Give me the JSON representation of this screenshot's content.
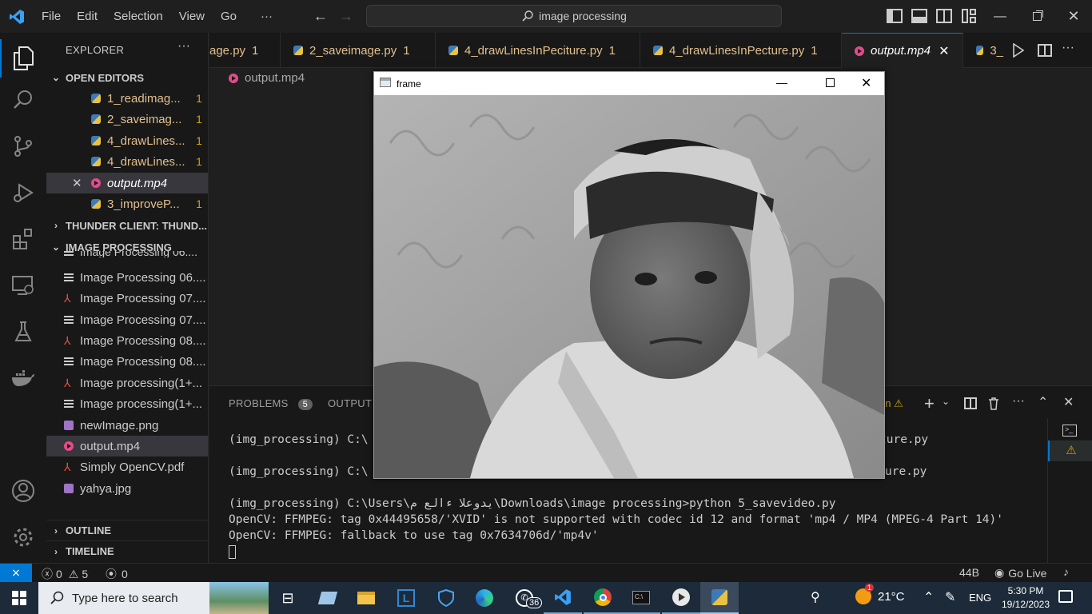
{
  "titlebar": {
    "menus": [
      "File",
      "Edit",
      "Selection",
      "View",
      "Go",
      "···"
    ],
    "search_text": "image processing"
  },
  "sidebar": {
    "explorer_title": "EXPLORER",
    "open_editors_title": "OPEN EDITORS",
    "open_editors": [
      {
        "label": "1_readimag...",
        "badge": "1",
        "type": "py"
      },
      {
        "label": "2_saveimag...",
        "badge": "1",
        "type": "py"
      },
      {
        "label": "4_drawLines...",
        "badge": "1",
        "type": "py"
      },
      {
        "label": "4_drawLines...",
        "badge": "1",
        "type": "py"
      },
      {
        "label": "output.mp4",
        "badge": "",
        "type": "mp4"
      },
      {
        "label": "3_improveP...",
        "badge": "1",
        "type": "py"
      }
    ],
    "thunder_title": "THUNDER CLIENT: THUND...",
    "folder_title": "IMAGE PROCESSING",
    "files": [
      {
        "label": "Image Processing 06....",
        "type": "txt"
      },
      {
        "label": "Image Processing 07....",
        "type": "pdf"
      },
      {
        "label": "Image Processing 07....",
        "type": "txt"
      },
      {
        "label": "Image Processing 08....",
        "type": "pdf"
      },
      {
        "label": "Image Processing 08....",
        "type": "txt"
      },
      {
        "label": "Image processing(1+...",
        "type": "pdf"
      },
      {
        "label": "Image processing(1+...",
        "type": "txt"
      },
      {
        "label": "newImage.png",
        "type": "png"
      },
      {
        "label": "output.mp4",
        "type": "mp4"
      },
      {
        "label": "Simply OpenCV.pdf",
        "type": "pdf"
      },
      {
        "label": "yahya.jpg",
        "type": "png"
      }
    ],
    "partial_file": "Image Processing 06....",
    "outline_title": "OUTLINE",
    "timeline_title": "TIMELINE"
  },
  "tabs": [
    {
      "label": "age.py",
      "num": "1"
    },
    {
      "label": "2_saveimage.py",
      "num": "1"
    },
    {
      "label": "4_drawLinesInPeciture.py",
      "num": "1"
    },
    {
      "label": "4_drawLinesInPecture.py",
      "num": "1"
    },
    {
      "label": "output.mp4",
      "num": ""
    },
    {
      "label": "3_",
      "num": ""
    }
  ],
  "editor": {
    "breadcrumb": "output.mp4"
  },
  "panel": {
    "problems_label": "PROBLEMS",
    "problems_count": "5",
    "output_label": "OUTPUT",
    "partial_label": "on",
    "terminal_lines": [
      "(img_processing) C:\\",
      "ture.py",
      "(img_processing) C:\\",
      "ure.py",
      "(img_processing) C:\\Users\\يدوعلا ءالع م\\Downloads\\image processing>python 5_savevideo.py",
      "OpenCV: FFMPEG: tag 0x44495658/'XVID' is not supported with codec id 12 and format 'mp4 / MP4 (MPEG-4 Part 14)'",
      "OpenCV: FFMPEG: fallback to use tag 0x7634706d/'mp4v'"
    ]
  },
  "statusbar": {
    "errors": "0",
    "warnings": "5",
    "ports": "0",
    "size": "44B",
    "golive": "Go Live"
  },
  "frame_window": {
    "title": "frame"
  },
  "taskbar": {
    "search_placeholder": "Type here to search",
    "whatsapp_badge": "36",
    "weather_badge": "1",
    "temperature": "21°C",
    "language": "ENG",
    "time": "5:30 PM",
    "date": "19/12/2023"
  },
  "colors": {
    "accent": "#0078d4",
    "modified": "#e2c08d",
    "warning": "#cca700"
  }
}
